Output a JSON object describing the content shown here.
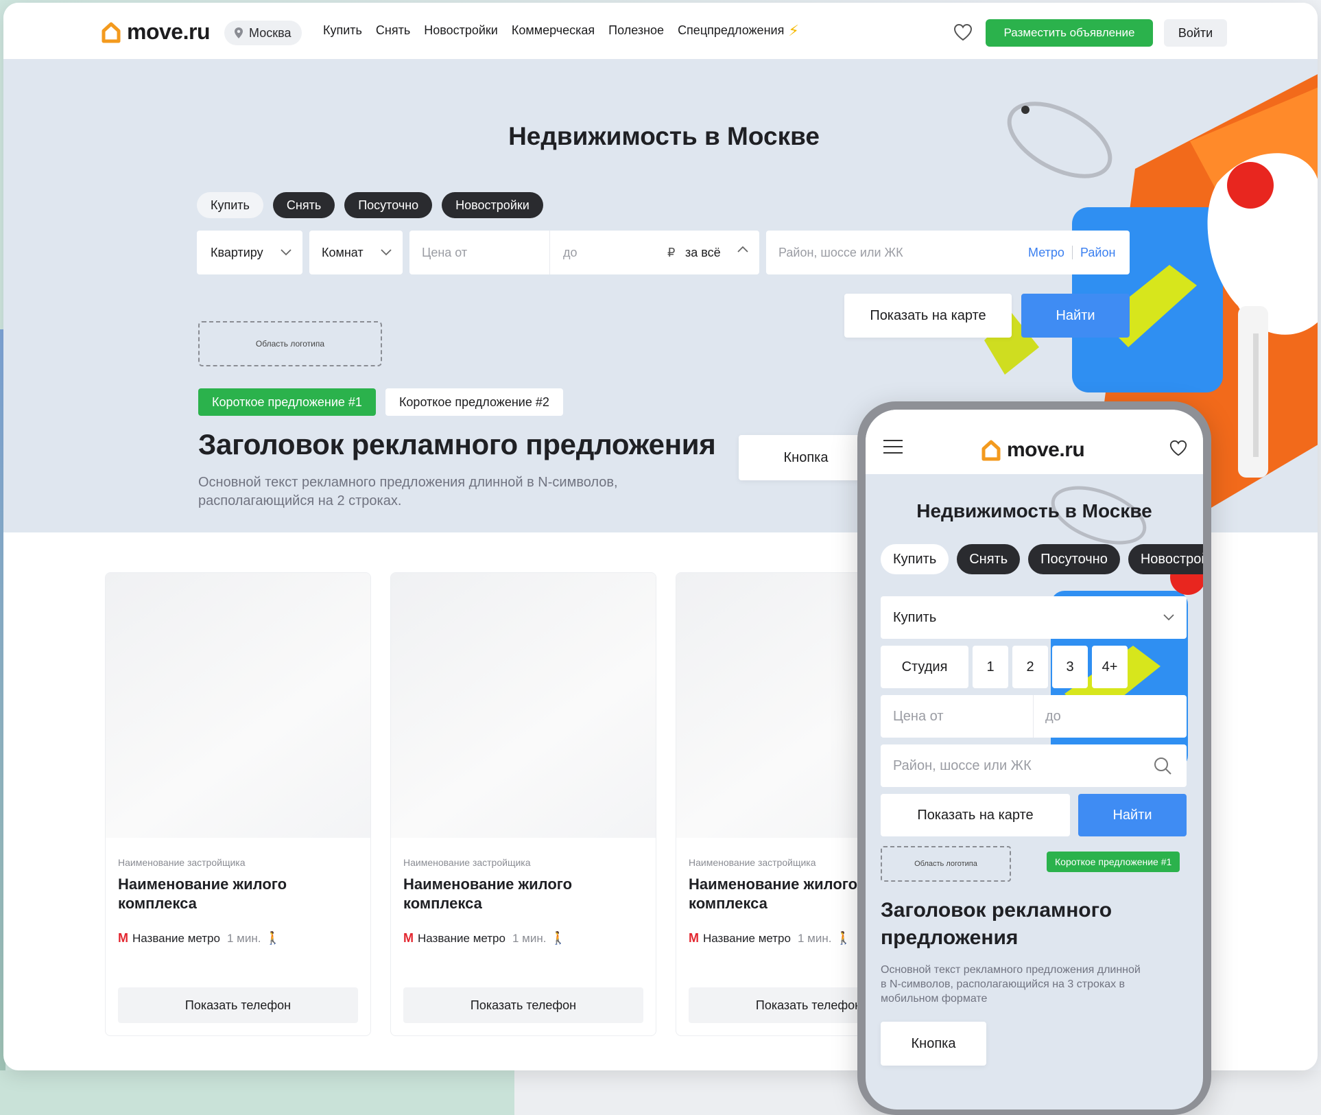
{
  "brand": {
    "name": "move.ru",
    "accent_green": "#2bb24c",
    "accent_blue": "#3f8cf3",
    "logo_orange": "#f39a1e"
  },
  "header": {
    "city": "Москва",
    "nav": [
      "Купить",
      "Снять",
      "Новостройки",
      "Коммерческая",
      "Полезное",
      "Спецпредложения"
    ],
    "post_ad": "Разместить объявление",
    "login": "Войти"
  },
  "hero": {
    "title": "Недвижимость в Москве",
    "tabs": [
      "Купить",
      "Снять",
      "Посуточно",
      "Новостройки"
    ],
    "filters": {
      "type": "Квартиру",
      "rooms": "Комнат",
      "price_from": "Цена от",
      "price_to": "до",
      "currency": "₽",
      "price_mode": "за всё",
      "location_placeholder": "Район, шоссе или ЖК",
      "metro": "Метро",
      "district": "Район"
    },
    "show_on_map": "Показать на карте",
    "find": "Найти",
    "logo_area": "Область логотипа",
    "offers": [
      "Короткое предложение #1",
      "Короткое предложение #2"
    ],
    "promo_title": "Заголовок рекламного предложения",
    "promo_text": "Основной текст рекламного предложения длинной в N-символов, располагающийся на 2 строках.",
    "promo_button": "Кнопка"
  },
  "cards": [
    {
      "developer": "Наименование застройщика",
      "name": "Наименование жилого комплекса",
      "metro": "Название метро",
      "walk": "1 мин.",
      "button": "Показать телефон"
    },
    {
      "developer": "Наименование застройщика",
      "name": "Наименование жилого комплекса",
      "metro": "Название метро",
      "walk": "1 мин.",
      "button": "Показать телефон"
    },
    {
      "developer": "Наименование застройщика",
      "name": "Наименование жилого комплекса",
      "metro": "Название метро",
      "walk": "1 мин.",
      "button": "Показать телефон"
    }
  ],
  "mobile": {
    "title": "Недвижимость в Москве",
    "tabs": [
      "Купить",
      "Снять",
      "Посуточно",
      "Новостройки"
    ],
    "deal_select": "Купить",
    "rooms": [
      "Студия",
      "1",
      "2",
      "3",
      "4+"
    ],
    "price_from": "Цена от",
    "price_to": "до",
    "search_placeholder": "Район, шоссе или ЖК",
    "show_on_map": "Показать на карте",
    "find": "Найти",
    "logo_area": "Область логотипа",
    "offer": "Короткое предложение #1",
    "promo_title": "Заголовок рекламного предложения",
    "promo_text": "Основной текст рекламного предложения длинной в N-символов, располагающийся на 3 строках в мобильном формате",
    "promo_button": "Кнопка"
  }
}
